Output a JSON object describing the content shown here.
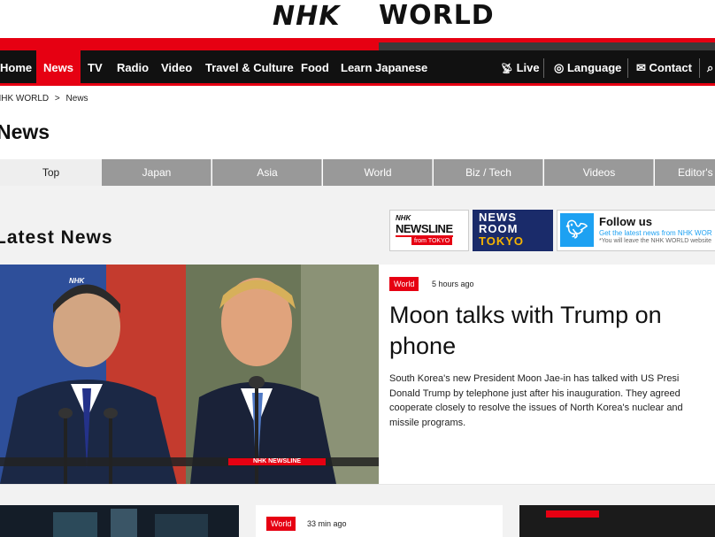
{
  "header": {
    "logo_left": "NHK",
    "logo_right": "WORLD"
  },
  "nav": {
    "items": [
      "Home",
      "News",
      "TV",
      "Radio",
      "Video",
      "Travel & Culture",
      "Food",
      "Learn Japanese"
    ],
    "active": "News",
    "right": [
      "Live",
      "Language",
      "Contact"
    ]
  },
  "breadcrumb": [
    "NHK WORLD",
    ">",
    "News"
  ],
  "page_title": "News",
  "tabs": [
    "Top",
    "Japan",
    "Asia",
    "World",
    "Biz / Tech",
    "Videos",
    "Editor's"
  ],
  "active_tab": "Top",
  "section_title": "Latest News",
  "banners": {
    "newsline": {
      "brand": "NHK",
      "name": "NEWSLINE",
      "sub": "from TOKYO"
    },
    "newsroom": {
      "line1": "NEWS",
      "line2": "ROOM",
      "line3": "TOKYO"
    },
    "twitter": {
      "title": "Follow us",
      "line1": "Get the latest news from NHK WOR",
      "line2": "*You will leave the NHK WORLD website"
    }
  },
  "featured": {
    "badge": "World",
    "time": "5 hours ago",
    "title_line1": "Moon talks with Trump on",
    "title_line2": "phone",
    "summary_lines": [
      "South Korea's new President Moon Jae-in has talked with US Presi",
      "Donald Trump by telephone just after his inauguration. They agreed",
      "cooperate closely to resolve the issues of North Korea's nuclear and",
      "missile programs."
    ],
    "image_watermark": "NHK NEWSLINE",
    "image_corner": "NHK"
  },
  "cards": [
    {
      "badge": "World",
      "time": "33 min ago"
    }
  ],
  "colors": {
    "accent": "#e60012",
    "nav_bg": "#111111",
    "tab_bg": "#999999"
  }
}
